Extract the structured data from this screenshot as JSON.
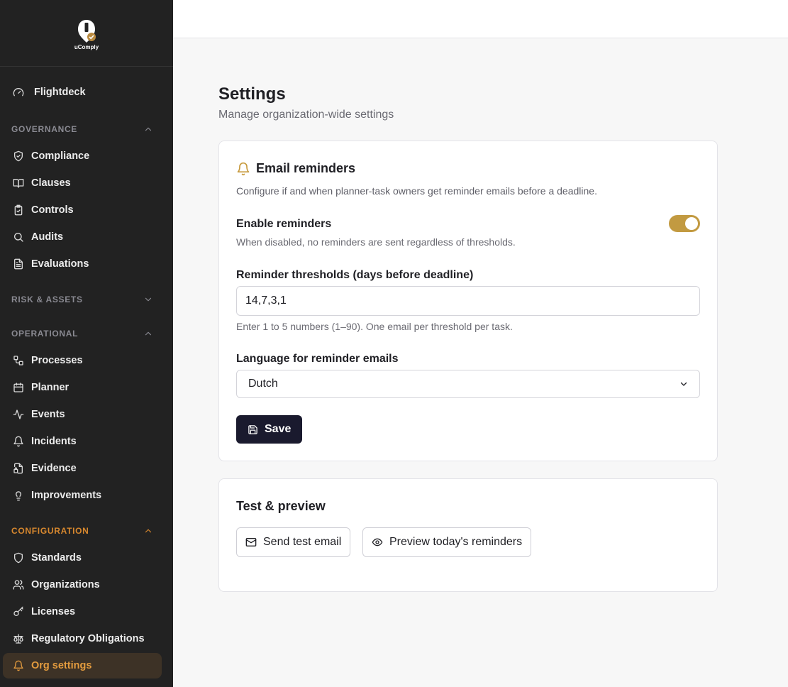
{
  "brand": {
    "name": "uComply",
    "accent": "#c29a41",
    "active_color": "#e39b3e"
  },
  "sidebar": {
    "flightdeck": "Flightdeck",
    "sections": {
      "governance": "GOVERNANCE",
      "risk_assets": "RISK & ASSETS",
      "operational": "OPERATIONAL",
      "configuration": "CONFIGURATION"
    },
    "governance_items": [
      "Compliance",
      "Clauses",
      "Controls",
      "Audits",
      "Evaluations"
    ],
    "operational_items": [
      "Processes",
      "Planner",
      "Events",
      "Incidents",
      "Evidence",
      "Improvements"
    ],
    "configuration_items": [
      "Standards",
      "Organizations",
      "Licenses",
      "Regulatory Obligations",
      "Org settings"
    ],
    "active_item": "Org settings"
  },
  "page": {
    "title": "Settings",
    "subtitle": "Manage organization-wide settings"
  },
  "email_reminders": {
    "title": "Email reminders",
    "description": "Configure if and when planner-task owners get reminder emails before a deadline.",
    "enable_label": "Enable reminders",
    "enable_hint": "When disabled, no reminders are sent regardless of thresholds.",
    "enabled": true,
    "thresholds_label": "Reminder thresholds (days before deadline)",
    "thresholds_value": "14,7,3,1",
    "thresholds_hint": "Enter 1 to 5 numbers (1–90). One email per threshold per task.",
    "language_label": "Language for reminder emails",
    "language_value": "Dutch",
    "save_label": "Save"
  },
  "test_preview": {
    "title": "Test & preview",
    "send_test_label": "Send test email",
    "preview_label": "Preview today's reminders"
  }
}
